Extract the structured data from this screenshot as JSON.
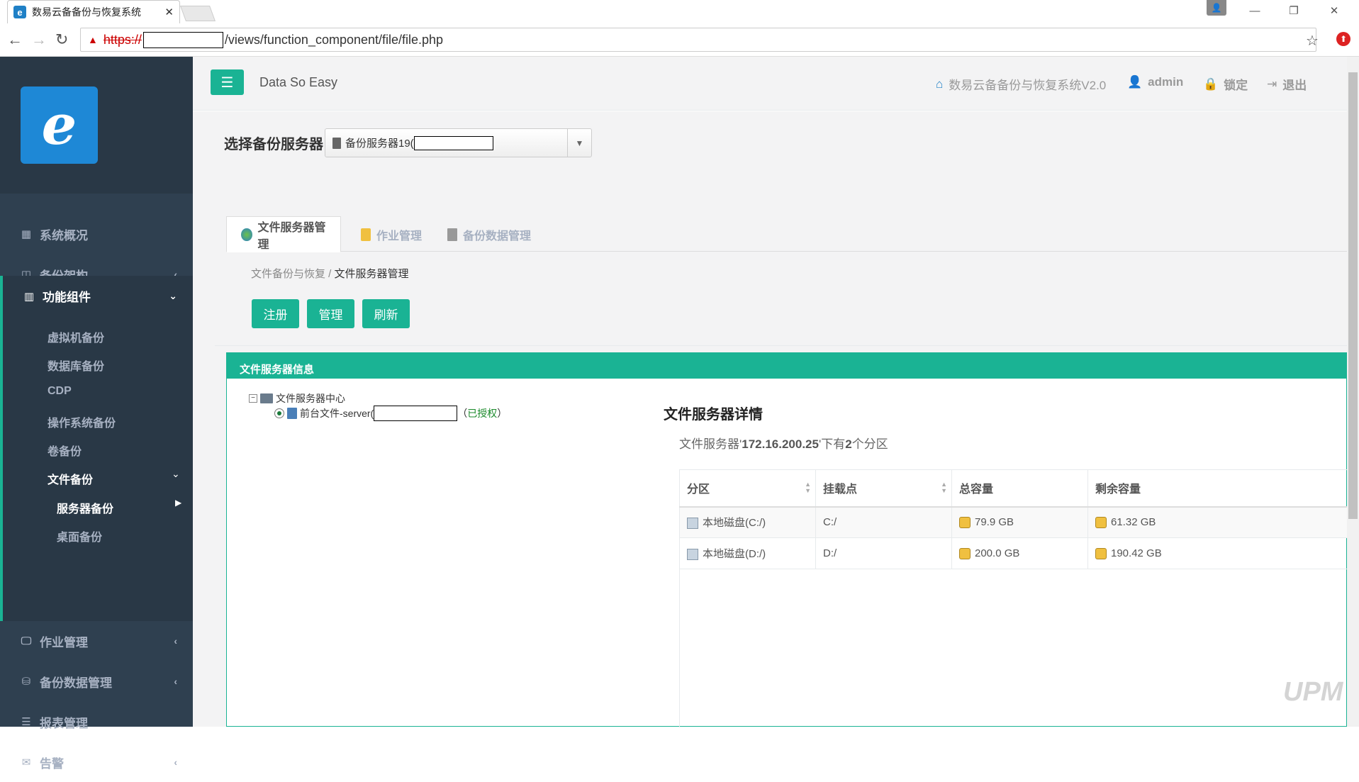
{
  "browser": {
    "tab_title": "数易云备备份与恢复系统",
    "url_scheme": "https://",
    "url_path": "/views/function_component/file/file.php"
  },
  "sidebar": {
    "menu": [
      {
        "label": "系统概况",
        "icon": "dashboard-icon"
      },
      {
        "label": "备份架构",
        "icon": "columns-icon"
      },
      {
        "label": "功能组件",
        "icon": "bar-chart-icon"
      },
      {
        "label": "作业管理",
        "icon": "desktop-icon"
      },
      {
        "label": "备份数据管理",
        "icon": "database-icon"
      },
      {
        "label": "报表管理",
        "icon": "list-icon"
      },
      {
        "label": "告警",
        "icon": "envelope-icon"
      }
    ],
    "sub": [
      "虚拟机备份",
      "数据库备份",
      "CDP",
      "操作系统备份",
      "卷备份",
      "文件备份"
    ],
    "subsub": [
      "服务器备份",
      "桌面备份"
    ]
  },
  "header": {
    "brand": "Data So Easy",
    "system_name": "数易云备备份与恢复系统V2.0",
    "user": "admin",
    "lock": "锁定",
    "logout": "退出"
  },
  "server_select": {
    "label": "选择备份服务器",
    "value": "备份服务器19("
  },
  "tabs": [
    {
      "label": "文件服务器管理"
    },
    {
      "label": "作业管理"
    },
    {
      "label": "备份数据管理"
    }
  ],
  "breadcrumb": {
    "parent": "文件备份与恢复 /",
    "current": "文件服务器管理"
  },
  "buttons": {
    "register": "注册",
    "manage": "管理",
    "refresh": "刷新"
  },
  "info_panel": {
    "title": "文件服务器信息",
    "tree_root": "文件服务器中心",
    "tree_child": "前台文件-server(",
    "tree_child_open": "（",
    "tree_child_status": "已授权",
    "tree_child_close": "）"
  },
  "detail": {
    "title": "文件服务器详情",
    "sub_prefix": "文件服务器'",
    "server_ip": "172.16.200.25",
    "sub_mid": "'下有",
    "partition_count": "2",
    "sub_suffix": "个分区",
    "columns": [
      "分区",
      "挂载点",
      "总容量",
      "剩余容量"
    ],
    "rows": [
      {
        "partition": "本地磁盘(C:/)",
        "mount": "C:/",
        "total": "79.9 GB",
        "free": "61.32 GB"
      },
      {
        "partition": "本地磁盘(D:/)",
        "mount": "D:/",
        "total": "200.0 GB",
        "free": "190.42 GB"
      }
    ]
  },
  "watermark": "UPM",
  "colors": {
    "accent": "#1ab394",
    "sidebar": "#2f4050"
  }
}
